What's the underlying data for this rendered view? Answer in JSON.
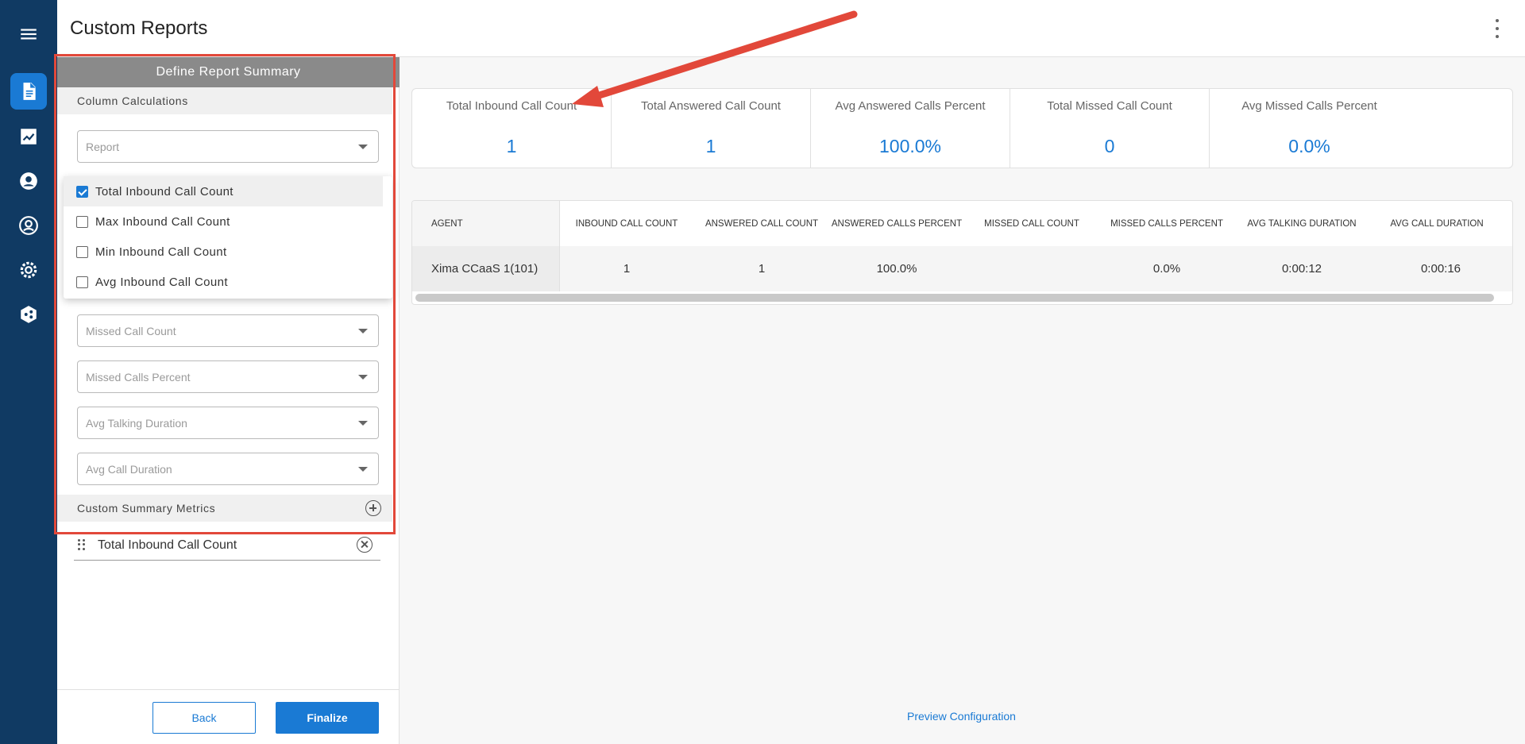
{
  "header": {
    "title": "Custom Reports",
    "menu_icon": "more-vert-icon"
  },
  "nav_rail": [
    {
      "icon": "menu-icon"
    },
    {
      "icon": "report-document-icon",
      "active": true
    },
    {
      "icon": "trending-chart-icon"
    },
    {
      "icon": "person-icon"
    },
    {
      "icon": "account-circle-icon"
    },
    {
      "icon": "settings-gear-icon"
    },
    {
      "icon": "integration-hub-icon"
    }
  ],
  "left_panel": {
    "title": "Define Report Summary",
    "column_calculations_label": "Column Calculations",
    "report_select_placeholder": "Report",
    "dropdown_options": [
      {
        "label": "Total Inbound Call Count",
        "checked": true
      },
      {
        "label": "Max Inbound Call Count",
        "checked": false
      },
      {
        "label": "Min Inbound Call Count",
        "checked": false
      },
      {
        "label": "Avg Inbound Call Count",
        "checked": false
      }
    ],
    "selects": [
      {
        "placeholder": "Missed Call Count"
      },
      {
        "placeholder": "Missed Calls Percent"
      },
      {
        "placeholder": "Avg Talking Duration"
      },
      {
        "placeholder": "Avg Call Duration"
      }
    ],
    "custom_metrics_label": "Custom Summary Metrics",
    "custom_metrics": [
      {
        "name": "Total Inbound Call Count"
      }
    ],
    "back_label": "Back",
    "finalize_label": "Finalize"
  },
  "summary": [
    {
      "label": "Total Inbound Call Count",
      "value": "1"
    },
    {
      "label": "Total Answered Call Count",
      "value": "1"
    },
    {
      "label": "Avg Answered Calls Percent",
      "value": "100.0%"
    },
    {
      "label": "Total Missed Call Count",
      "value": "0"
    },
    {
      "label": "Avg Missed Calls Percent",
      "value": "0.0%"
    }
  ],
  "table": {
    "headers": [
      "AGENT",
      "INBOUND CALL COUNT",
      "ANSWERED CALL COUNT",
      "ANSWERED CALLS PERCENT",
      "MISSED CALL COUNT",
      "MISSED CALLS PERCENT",
      "AVG TALKING DURATION",
      "AVG CALL DURATION"
    ],
    "rows": [
      [
        "Xima CCaaS 1(101)",
        "1",
        "1",
        "100.0%",
        "",
        "0.0%",
        "0:00:12",
        "0:00:16"
      ]
    ]
  },
  "preview_link": "Preview Configuration",
  "colors": {
    "rail": "#103a63",
    "accent": "#1a7ad4",
    "annotation": "#e2483a"
  }
}
